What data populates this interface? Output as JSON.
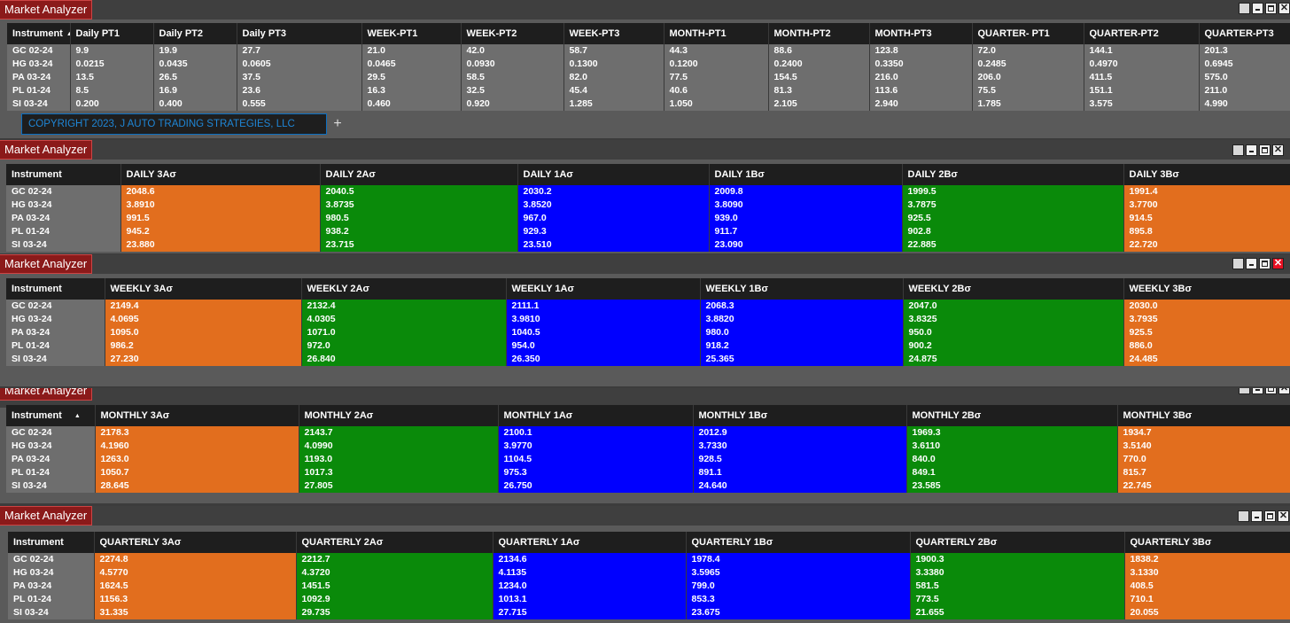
{
  "app_title": "Market Analyzer",
  "copyright": "COPYRIGHT 2023, J AUTO TRADING STRATEGIES, LLC",
  "add_tab_label": "+",
  "colors": {
    "orange": "#e26e1e",
    "green": "#0a8a0a",
    "blue": "#0000ff",
    "title_red": "#8b1a1a"
  },
  "instruments": [
    "GC 02-24",
    "HG 03-24",
    "PA 03-24",
    "PL 01-24",
    "SI 03-24"
  ],
  "panels": [
    {
      "id": "targets",
      "title": "Market Analyzer",
      "instrument_header": "Instrument",
      "columns": [
        "Daily PT1",
        "Daily PT2",
        "Daily PT3",
        "WEEK-PT1",
        "WEEK-PT2",
        "WEEK-PT3",
        "MONTH-PT1",
        "MONTH-PT2",
        "MONTH-PT3",
        "QUARTER- PT1",
        "QUARTER-PT2",
        "QUARTER-PT3"
      ],
      "rows": [
        [
          "9.9",
          "19.9",
          "27.7",
          "21.0",
          "42.0",
          "58.7",
          "44.3",
          "88.6",
          "123.8",
          "72.0",
          "144.1",
          "201.3"
        ],
        [
          "0.0215",
          "0.0435",
          "0.0605",
          "0.0465",
          "0.0930",
          "0.1300",
          "0.1200",
          "0.2400",
          "0.3350",
          "0.2485",
          "0.4970",
          "0.6945"
        ],
        [
          "13.5",
          "26.5",
          "37.5",
          "29.5",
          "58.5",
          "82.0",
          "77.5",
          "154.5",
          "216.0",
          "206.0",
          "411.5",
          "575.0"
        ],
        [
          "8.5",
          "16.9",
          "23.6",
          "16.3",
          "32.5",
          "45.4",
          "40.6",
          "81.3",
          "113.6",
          "75.5",
          "151.1",
          "211.0"
        ],
        [
          "0.200",
          "0.400",
          "0.555",
          "0.460",
          "0.920",
          "1.285",
          "1.050",
          "2.105",
          "2.940",
          "1.785",
          "3.575",
          "4.990"
        ]
      ]
    },
    {
      "id": "daily",
      "title": "Market Analyzer",
      "instrument_header": "Instrument",
      "columns": [
        "DAILY 3Aσ",
        "DAILY 2Aσ",
        "DAILY 1Aσ",
        "DAILY 1Bσ",
        "DAILY 2Bσ",
        "DAILY 3Bσ"
      ],
      "rows": [
        [
          "2048.6",
          "2040.5",
          "2030.2",
          "2009.8",
          "1999.5",
          "1991.4"
        ],
        [
          "3.8910",
          "3.8735",
          "3.8520",
          "3.8090",
          "3.7875",
          "3.7700"
        ],
        [
          "991.5",
          "980.5",
          "967.0",
          "939.0",
          "925.5",
          "914.5"
        ],
        [
          "945.2",
          "938.2",
          "929.3",
          "911.7",
          "902.8",
          "895.8"
        ],
        [
          "23.880",
          "23.715",
          "23.510",
          "23.090",
          "22.885",
          "22.720"
        ]
      ]
    },
    {
      "id": "weekly",
      "title": "Market Analyzer",
      "instrument_header": "Instrument",
      "columns": [
        "WEEKLY 3Aσ",
        "WEEKLY 2Aσ",
        "WEEKLY 1Aσ",
        "WEEKLY 1Bσ",
        "WEEKLY 2Bσ",
        "WEEKLY 3Bσ"
      ],
      "rows": [
        [
          "2149.4",
          "2132.4",
          "2111.1",
          "2068.3",
          "2047.0",
          "2030.0"
        ],
        [
          "4.0695",
          "4.0305",
          "3.9810",
          "3.8820",
          "3.8325",
          "3.7935"
        ],
        [
          "1095.0",
          "1071.0",
          "1040.5",
          "980.0",
          "950.0",
          "925.5"
        ],
        [
          "986.2",
          "972.0",
          "954.0",
          "918.2",
          "900.2",
          "886.0"
        ],
        [
          "27.230",
          "26.840",
          "26.350",
          "25.365",
          "24.875",
          "24.485"
        ]
      ]
    },
    {
      "id": "monthly",
      "title": "Market Analyzer",
      "instrument_header": "Instrument",
      "columns": [
        "MONTHLY 3Aσ",
        "MONTHLY 2Aσ",
        "MONTHLY 1Aσ",
        "MONTHLY 1Bσ",
        "MONTHLY 2Bσ",
        "MONTHLY 3Bσ"
      ],
      "rows": [
        [
          "2178.3",
          "2143.7",
          "2100.1",
          "2012.9",
          "1969.3",
          "1934.7"
        ],
        [
          "4.1960",
          "4.0990",
          "3.9770",
          "3.7330",
          "3.6110",
          "3.5140"
        ],
        [
          "1263.0",
          "1193.0",
          "1104.5",
          "928.5",
          "840.0",
          "770.0"
        ],
        [
          "1050.7",
          "1017.3",
          "975.3",
          "891.1",
          "849.1",
          "815.7"
        ],
        [
          "28.645",
          "27.805",
          "26.750",
          "24.640",
          "23.585",
          "22.745"
        ]
      ]
    },
    {
      "id": "quarterly",
      "title": "Market Analyzer",
      "instrument_header": "Instrument",
      "columns": [
        "QUARTERLY 3Aσ",
        "QUARTERLY 2Aσ",
        "QUARTERLY 1Aσ",
        "QUARTERLY 1Bσ",
        "QUARTERLY 2Bσ",
        "QUARTERLY 3Bσ"
      ],
      "rows": [
        [
          "2274.8",
          "2212.7",
          "2134.6",
          "1978.4",
          "1900.3",
          "1838.2"
        ],
        [
          "4.5770",
          "4.3720",
          "4.1135",
          "3.5965",
          "3.3380",
          "3.1330"
        ],
        [
          "1624.5",
          "1451.5",
          "1234.0",
          "799.0",
          "581.5",
          "408.5"
        ],
        [
          "1156.3",
          "1092.9",
          "1013.1",
          "853.3",
          "773.5",
          "710.1"
        ],
        [
          "31.335",
          "29.735",
          "27.715",
          "23.675",
          "21.655",
          "20.055"
        ]
      ]
    }
  ]
}
